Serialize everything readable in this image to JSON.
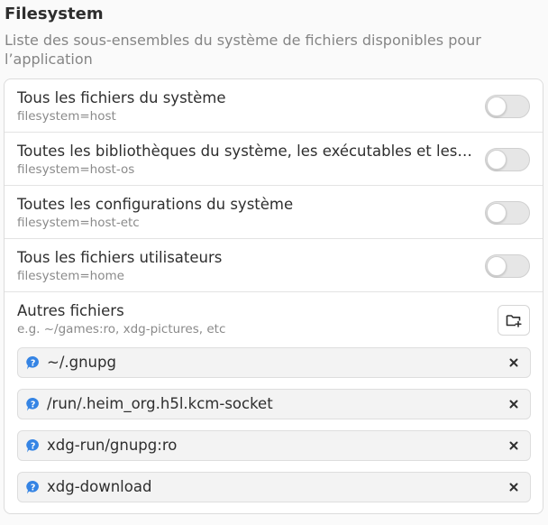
{
  "section": {
    "title": "Filesystem",
    "description": "Liste des sous-ensembles du système de fichiers disponibles pour l’application"
  },
  "toggles": [
    {
      "title": "Tous les fichiers du système",
      "subtitle": "filesystem=host",
      "enabled": false
    },
    {
      "title": "Toutes les bibliothèques du système, les exécutables et les binaires",
      "subtitle": "filesystem=host-os",
      "enabled": false
    },
    {
      "title": "Toutes les configurations du système",
      "subtitle": "filesystem=host-etc",
      "enabled": false
    },
    {
      "title": "Tous les fichiers utilisateurs",
      "subtitle": "filesystem=home",
      "enabled": false
    }
  ],
  "other_files": {
    "title": "Autres fichiers",
    "subtitle": "e.g. ~/games:ro, xdg-pictures, etc",
    "add_icon": "folder-add-icon",
    "entries": [
      {
        "path": "~/.gnupg",
        "icon": "question-icon"
      },
      {
        "path": "/run/.heim_org.h5l.kcm-socket",
        "icon": "question-icon"
      },
      {
        "path": "xdg-run/gnupg:ro",
        "icon": "question-icon"
      },
      {
        "path": "xdg-download",
        "icon": "question-icon"
      }
    ]
  },
  "colors": {
    "accent": "#3584e4",
    "switch_off": "#e6e6e6",
    "subtitle": "#8a8a8a"
  }
}
